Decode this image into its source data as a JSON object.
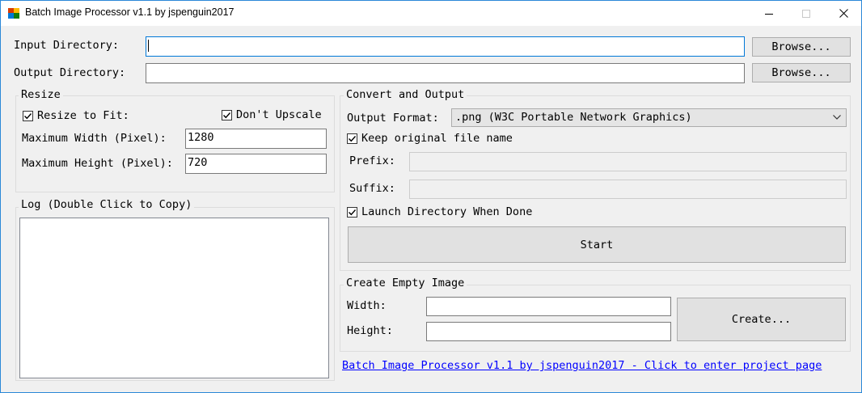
{
  "window": {
    "title": "Batch Image Processor v1.1 by jspenguin2017",
    "minimize": "—",
    "maximize": "☐",
    "close": "✕"
  },
  "input_dir": {
    "label": "Input Directory:",
    "value": "",
    "browse_label": "Browse..."
  },
  "output_dir": {
    "label": "Output Directory:",
    "value": "",
    "browse_label": "Browse..."
  },
  "resize": {
    "title": "Resize",
    "resize_to_fit_label": "Resize to Fit:",
    "resize_to_fit_checked": true,
    "dont_upscale_label": "Don't Upscale",
    "dont_upscale_checked": true,
    "max_width_label": "Maximum Width (Pixel):",
    "max_width_value": "1280",
    "max_height_label": "Maximum Height (Pixel):",
    "max_height_value": "720"
  },
  "log": {
    "title": "Log (Double Click to Copy)",
    "content": ""
  },
  "convert": {
    "title": "Convert and Output",
    "format_label": "Output Format:",
    "format_value": ".png (W3C Portable Network Graphics)",
    "keep_name_label": "Keep original file name",
    "keep_name_checked": true,
    "prefix_label": "Prefix:",
    "prefix_value": "",
    "suffix_label": "Suffix:",
    "suffix_value": "",
    "launch_label": "Launch Directory When Done",
    "launch_checked": true,
    "start_label": "Start"
  },
  "empty_image": {
    "title": "Create Empty Image",
    "width_label": "Width:",
    "width_value": "",
    "height_label": "Height:",
    "height_value": "",
    "create_label": "Create..."
  },
  "footer": {
    "link_text": "Batch Image Processor v1.1 by jspenguin2017 - Click to enter project page"
  }
}
